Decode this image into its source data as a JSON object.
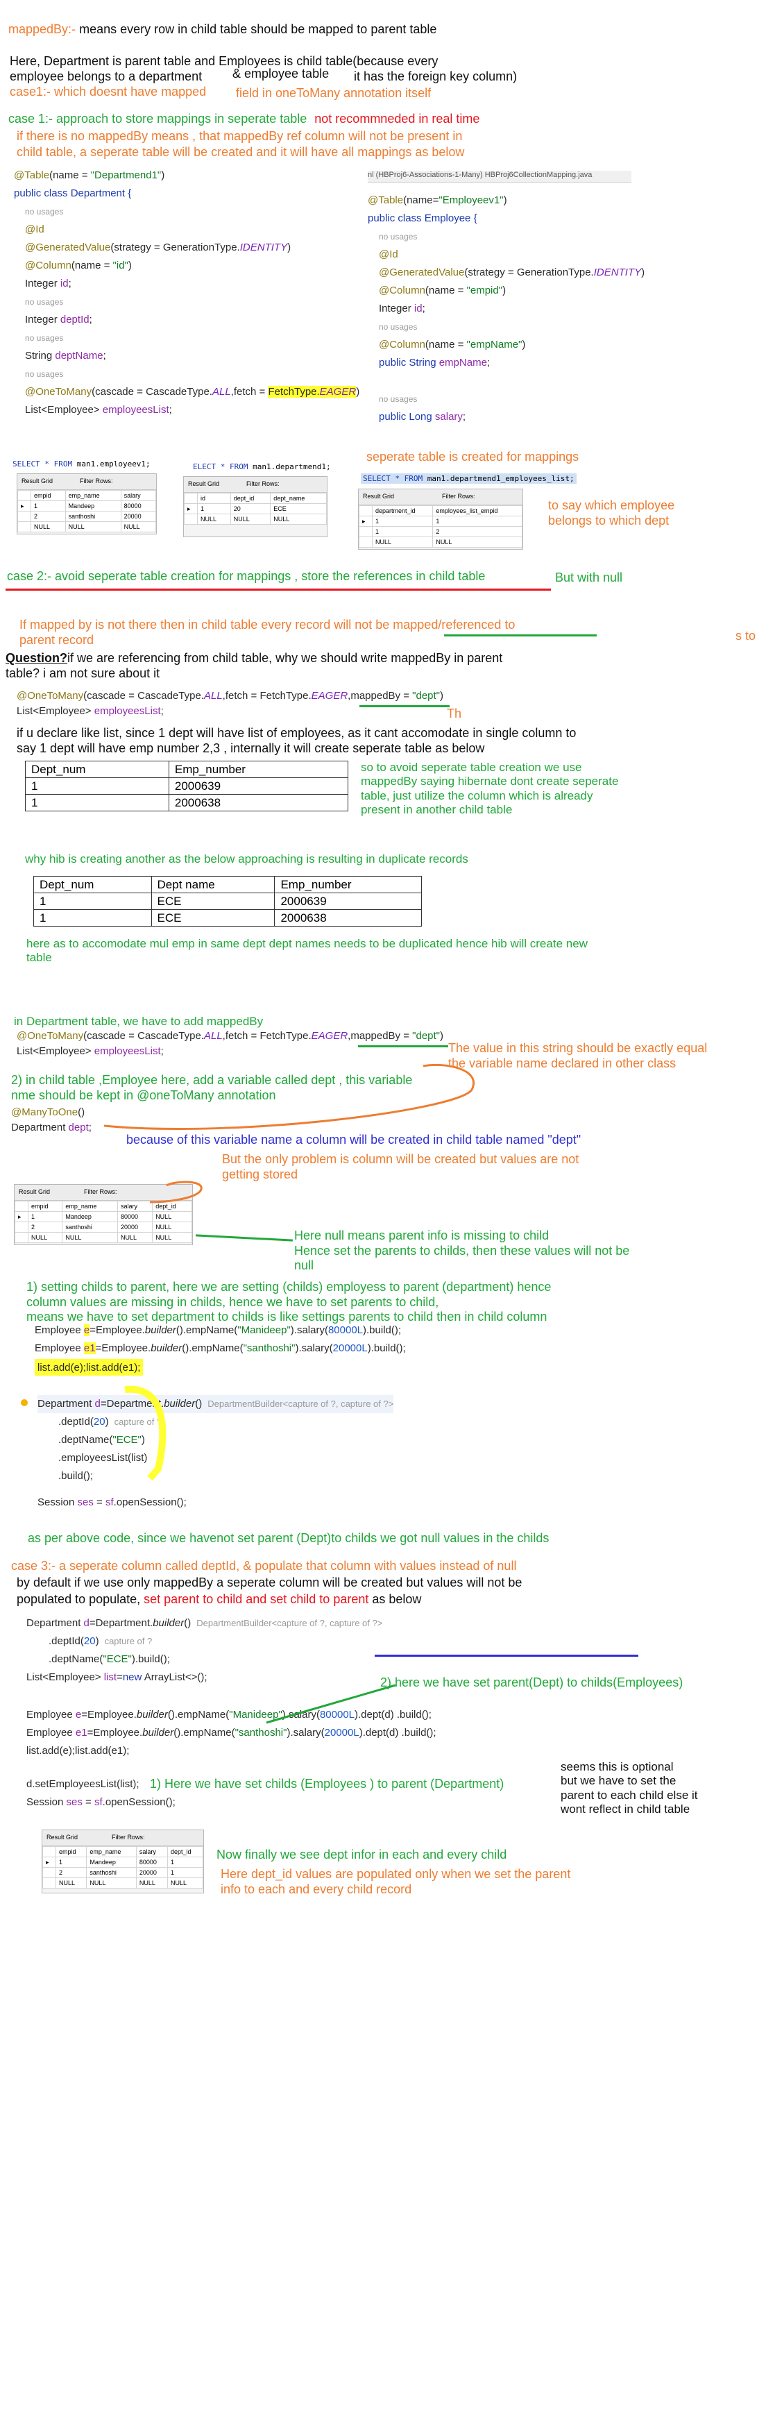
{
  "header": {
    "l1_a": "mappedBy:-",
    "l1_b": "means every row in child table should be mapped to parent table",
    "l2": "Here, Department is parent table and Employees is child table(because every",
    "l3a": "employee belongs to a department",
    "l3b": "& employee table",
    "l3c": "it has the foreign key column)",
    "l4": "case1:- which doesnt have mapped",
    "l4b": "field in oneToMany annotation itself"
  },
  "case1": {
    "title_a": "case 1:-  approach to store mappings in seperate table",
    "title_b": "not recommneded in real time",
    "note1": "if there is no mappedBy means , that mappedBy ref column will not be present in",
    "note2": "child table, a seperate table will be created and it will have all mappings as below"
  },
  "editor_tabs": "nl (HBProj6-Associations-1-Many)    HBProj6CollectionMapping.java",
  "code_dept": {
    "table_ann": "@Table",
    "table_rest": "(name = ",
    "table_str": "\"Departmend1\"",
    "cls": "public class Department {",
    "nousage": "no usages",
    "id": "@Id",
    "gen_a": "@GeneratedValue",
    "gen_b": "(strategy = GenerationType.",
    "gen_c": "IDENTITY",
    "col_a": "@Column",
    "col_b": "(name = ",
    "col_c": "\"id\"",
    "f1_a": "Integer ",
    "f1_b": "id",
    "f2_a": "Integer ",
    "f2_b": "deptId",
    "f3_a": "String ",
    "f3_b": "deptName",
    "otm_a": "@OneToMany",
    "otm_b": "(cascade = CascadeType.",
    "otm_c": "ALL",
    "otm_d": ",fetch = ",
    "otm_e": "FetchType.",
    "otm_f": "EAGER",
    "list_a": "List<Employee> ",
    "list_b": "employeesList",
    "semi": ";",
    "paren": ")"
  },
  "code_emp": {
    "table_ann": "@Table",
    "table_rest": "(name=",
    "table_str": "\"Employeev1\"",
    "cls": "public class Employee {",
    "nousage": "no usages",
    "id": "@Id",
    "gen_a": "@GeneratedValue",
    "gen_b": "(strategy = GenerationType.",
    "gen_c": "IDENTITY",
    "col1_c": "\"empid\"",
    "f1_b": "id",
    "col2_c": "\"empName\"",
    "f2_a": "public String ",
    "f2_b": "empName",
    "f3_a": "public Long ",
    "f3_b": "salary"
  },
  "sql1": {
    "q_a": "SELECT * FROM ",
    "q_b": "man1.employeev1;",
    "toolbar": "Result Grid",
    "filter": "Filter Rows:",
    "cols": [
      "empid",
      "emp_name",
      "salary"
    ],
    "rows": [
      [
        "1",
        "Mandeep",
        "80000"
      ],
      [
        "2",
        "santhoshi",
        "20000"
      ],
      [
        "NULL",
        "NULL",
        "NULL"
      ]
    ]
  },
  "sql2": {
    "q_a": "ELECT * FROM ",
    "q_b": "man1.departmend1;",
    "toolbar": "Result Grid",
    "filter": "Filter Rows:",
    "cols": [
      "id",
      "dept_id",
      "dept_name"
    ],
    "rows": [
      [
        "1",
        "20",
        "ECE"
      ],
      [
        "NULL",
        "NULL",
        "NULL"
      ]
    ]
  },
  "sql3": {
    "q_a": "SELECT * FROM ",
    "q_b": "man1.departmend1_employees_list;",
    "toolbar": "Result Grid",
    "filter": "Filter Rows:",
    "cols": [
      "department_id",
      "employees_list_empid"
    ],
    "rows": [
      [
        "1",
        "1"
      ],
      [
        "1",
        "2"
      ],
      [
        "NULL",
        "NULL"
      ]
    ]
  },
  "notes_sql": {
    "sep_created": "seperate table is created for mappings",
    "to_say": "to say which employee\nbelongs to which dept"
  },
  "case2": {
    "title": "case 2:-  avoid seperate table creation for mappings , store the references in child table",
    "but": "But with null",
    "ifmapped": "If mapped by is not there then in child table every record will not be mapped/referenced to\nparent record",
    "s_to": "s to",
    "q_a": "Question?",
    "q_b": "if we are referencing from child table, why we should write mappedBy in parent\n table? i am not sure about it",
    "code1_a": "@OneToMany",
    "code1_b": "(cascade = CascadeType.",
    "code1_c": "ALL",
    "code1_d": ",fetch = FetchType.",
    "code1_e": "EAGER",
    "code1_f": ",mappedBy = ",
    "code1_g": "\"dept\"",
    "code1_h": ")",
    "code2_a": "List<Employee> ",
    "code2_b": "employeesList",
    "th": "Th",
    "ifu": "if u declare like list, since 1 dept will have list of employees, as it cant accomodate in single column to\nsay 1 dept will have emp number 2,3 , internally it will create seperate table as below",
    "tab1": {
      "h": [
        "Dept_num",
        "Emp_number"
      ],
      "rows": [
        [
          "1",
          "2000639"
        ],
        [
          "1",
          "2000638"
        ]
      ]
    },
    "soavoid": "so to avoid seperate table creation we use\nmappedBy saying hibernate dont create seperate\ntable, just utilize the column which is already\npresent in another child table",
    "why": "why hib is creating another as the below approaching is resulting in duplicate records",
    "tab2": {
      "h": [
        "Dept_num",
        "Dept name",
        "Emp_number"
      ],
      "rows": [
        [
          "1",
          "ECE",
          "2000639"
        ],
        [
          "1",
          "ECE",
          "2000638"
        ]
      ]
    },
    "here": "here as to accomodate mul emp in same dept dept names needs to be duplicated hence hib will create new\ntable"
  },
  "step": {
    "indept": "in Department table, we have to add mappedBy",
    "code_a": "@OneToMany",
    "code_b": "(cascade = CascadeType.",
    "code_c": "ALL",
    "code_d": ",fetch = FetchType.",
    "code_e": "EAGER",
    "code_f": ",mappedBy = ",
    "code_g": "\"dept\"",
    "code_h": ")",
    "list_a": "List<Employee> ",
    "list_b": "employeesList",
    "valnote": "The value in this string should be exactly equal\nthe variable name declared in other class",
    "s2": "2) in child table ,Employee here, add a variable called dept , this variable\nnme should be kept in @oneToMany annotation",
    "mto": "@ManyToOne",
    "mto_b": "()",
    "dep_a": "Department ",
    "dep_b": "dept",
    "because": "because of this variable name a column will be created in child table named \"dept\"",
    "problem": "But the only problem is column will be created but values are not\ngetting stored",
    "grid_cols": [
      "empid",
      "emp_name",
      "salary",
      "dept_id"
    ],
    "grid_rows": [
      [
        "1",
        "Mandeep",
        "80000",
        "NULL"
      ],
      [
        "2",
        "santhoshi",
        "20000",
        "NULL"
      ],
      [
        "NULL",
        "NULL",
        "NULL",
        "NULL"
      ]
    ],
    "nullmeans": "Here null means parent info is missing to child\nHence set the parents to childs, then these values will not be\nnull",
    "s1": "1) setting childs to parent, here we are setting (childs) employess to parent (department) hence\ncolumn values are missing in childs, hence we have to set parents to child,\nmeans we have to set department to childs is like settings parents to child then in child column"
  },
  "code3": {
    "l1_a": "Employee ",
    "l1_b": "e",
    "l1_c": "=Employee.",
    "l1_d": "builder",
    "l1_e": "().empName(",
    "l1_f": "\"Manideep\"",
    "l1_g": ").salary(",
    "l1_h": "80000L",
    "l1_i": ").build();",
    "l2_b": "e1",
    "l2_f": "\"santhoshi\"",
    "l2_h": "20000L",
    "l3": "list.add(e);list.add(e1);",
    "dep_a": "Department ",
    "dep_b": "d",
    "dep_c": "=Department.",
    "dep_d": "builder",
    "dep_e": "()",
    "dep_hint": "DepartmentBuilder<capture of ?, capture of ?>",
    "did_a": ".deptId(",
    "did_b": "20",
    "did_c": ")",
    "did_hint": "capture of ?",
    "dn_a": ".deptName(",
    "dn_b": "\"ECE\"",
    "dn_c": ")",
    "el": ".employeesList(list)",
    "bld": ".build();",
    "ses_a": "Session ",
    "ses_b": "ses",
    "ses_c": " = ",
    "ses_d": "sf",
    "ses_e": ".openSession();"
  },
  "case3": {
    "asper": "as per above code, since we havenot set parent (Dept)to childs we got null values in the childs",
    "title": "case 3:- a seperate column called deptId, & populate that column with values instead of null",
    "default_a": "by default if we use only mappedBy a seperate column will be created but values will not be",
    "default_b": "populated to populate, ",
    "default_c": "set parent to child and set child to parent",
    "default_d": " as below"
  },
  "code4": {
    "d_a": "Department ",
    "d_b": "d",
    "d_c": "=Department.",
    "d_d": "builder",
    "d_e": "()",
    "d_hint": "DepartmentBuilder<capture of ?, capture of ?>",
    "did_a": ".deptId(",
    "did_b": "20",
    "did_c": ")",
    "did_hint": "capture of ?",
    "dn_a": ".deptName(",
    "dn_b": "\"ECE\"",
    "dn_c": ").build();",
    "list_a": "List<Employee> ",
    "list_b": "list",
    "list_c": "=",
    "list_d": "new",
    "list_e": " ArrayList<>();",
    "e1_a": "Employee ",
    "e1_b": "e",
    "e1_c": "=Employee.",
    "e1_d": "builder",
    "e1_e": "().empName(",
    "e1_f": "\"Manideep\"",
    "e1_g": ").salary(",
    "e1_h": "80000L",
    "e1_i": ").dept(d) .build();",
    "e2_b": "e1",
    "e2_f": "\"santhoshi\"",
    "e2_h": "20000L",
    "add": "list.add(e);list.add(e1);",
    "set_a": "d.setEmployeesList(list);",
    "ses_a": "Session ",
    "ses_b": "ses",
    "ses_c": " = ",
    "ses_d": "sf",
    "ses_e": ".openSession();"
  },
  "final": {
    "n2": "2) here we have set parent(Dept) to childs(Employees)",
    "n1": "1) Here we have set childs (Employees ) to parent (Department)",
    "optional": "seems this is optional\nbut we have to set the\nparent to each child else it\nwont reflect in child table",
    "grid_cols": [
      "empid",
      "emp_name",
      "salary",
      "dept_id"
    ],
    "grid_rows": [
      [
        "1",
        "Mandeep",
        "80000",
        "1"
      ],
      [
        "2",
        "santhoshi",
        "20000",
        "1"
      ],
      [
        "NULL",
        "NULL",
        "NULL",
        "NULL"
      ]
    ],
    "now": "Now finally we see dept infor in each and every child",
    "heredept": "Here dept_id values are populated only when we set the parent\ninfo to each and every child record",
    "toolbar": "Result Grid",
    "filter": "Filter Rows:"
  },
  "colors": {
    "orange": "#ed7d31",
    "green": "#22a83a",
    "red": "#e8141c",
    "blue": "#2f2fd6",
    "yellow": "#ffff33"
  }
}
